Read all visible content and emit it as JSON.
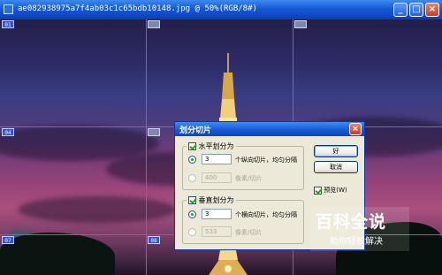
{
  "window": {
    "title": "ae082938975a7f4ab03c1c65bdb10148.jpg @ 50%(RGB/8#)",
    "controls": {
      "minimize": "_",
      "maximize": "□",
      "close": "×"
    }
  },
  "slices": {
    "labels": [
      "01",
      "04",
      "07",
      "08"
    ]
  },
  "dialog": {
    "title": "划分切片",
    "close_icon": "×",
    "horizontal": {
      "label": "水平划分为",
      "checked": true,
      "count_value": "3",
      "count_label": "个纵向切片，均匀分隔",
      "size_value": "400",
      "size_label": "像素/切片"
    },
    "vertical": {
      "label": "垂直划分为",
      "checked": true,
      "count_value": "3",
      "count_label": "个横向切片，均匀分隔",
      "size_value": "533",
      "size_label": "像素/切片"
    },
    "ok_label": "好",
    "cancel_label": "取消",
    "preview_label": "预览(W)",
    "preview_checked": true
  },
  "watermark": {
    "line1": "百科全说",
    "line2": "助你轻松解决"
  },
  "colors": {
    "slice_line": "#4d6ef6",
    "title_bar": "#1659d6",
    "dialog_bg": "#ece9d8"
  }
}
